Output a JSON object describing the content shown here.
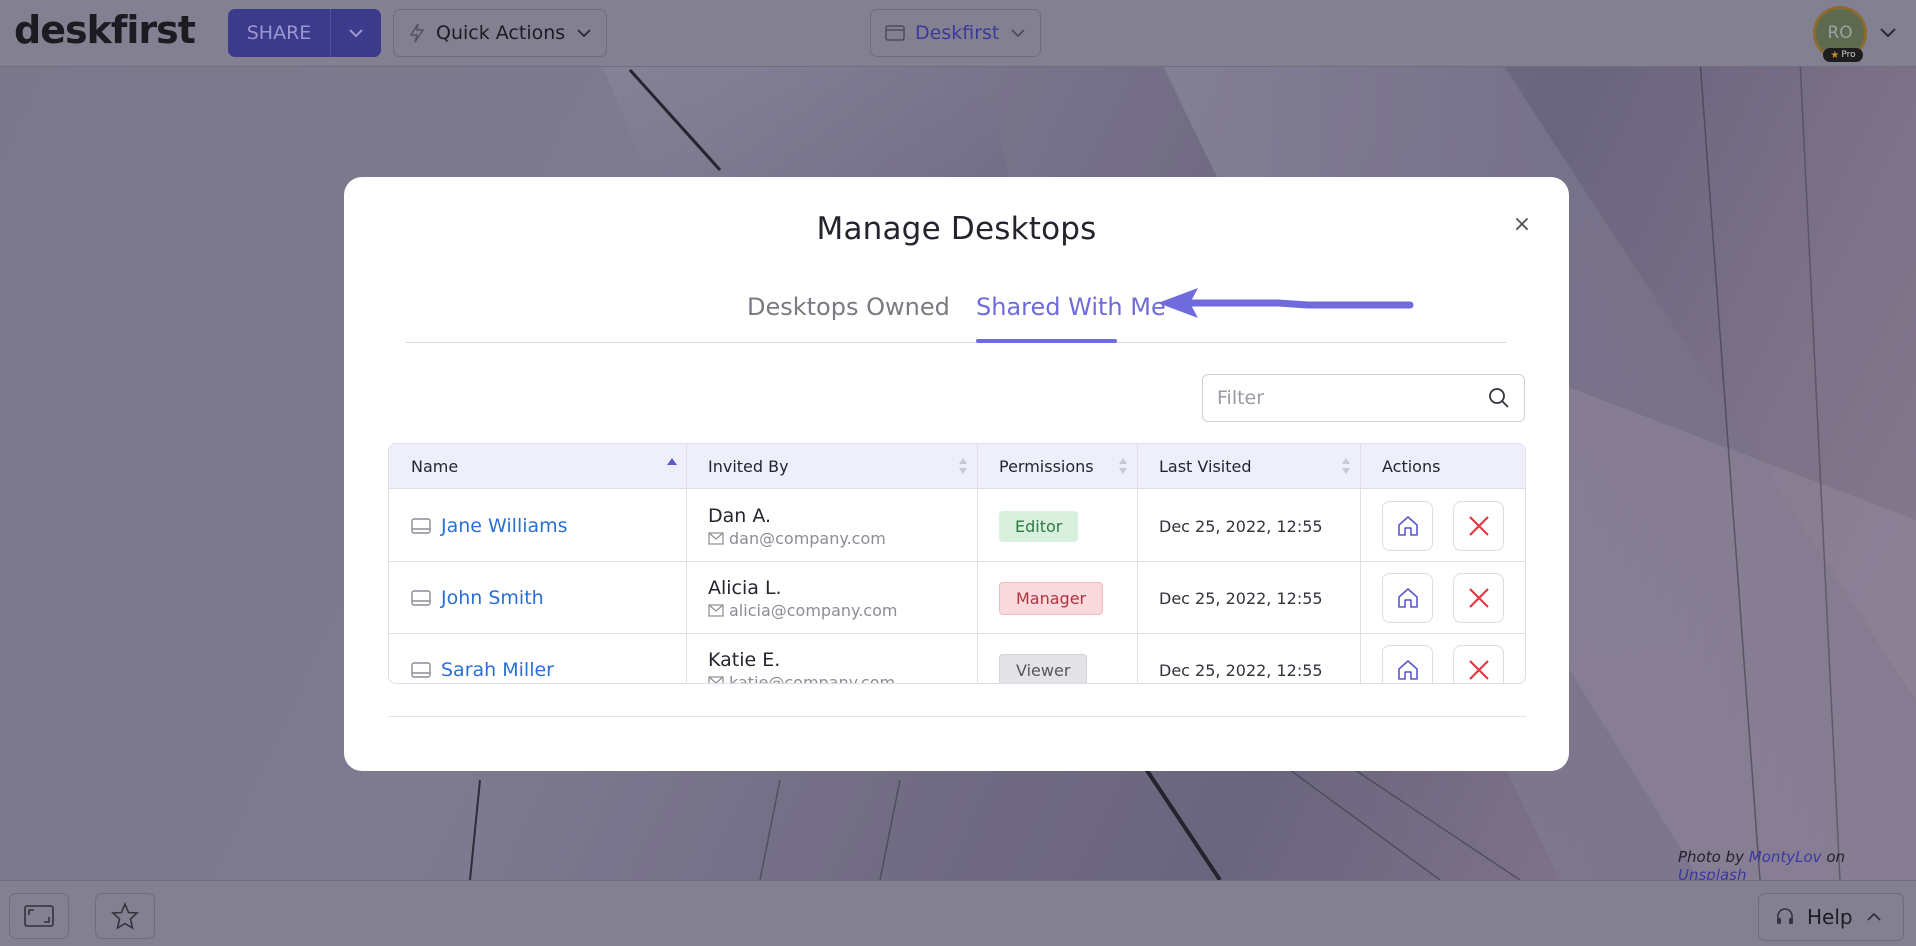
{
  "topbar": {
    "logo": "deskfirst",
    "share_label": "SHARE",
    "quick_actions_label": "Quick Actions",
    "desktop_label": "Deskfirst",
    "avatar_initials": "RO",
    "pro_label": "Pro"
  },
  "bottombar": {
    "help_label": "Help"
  },
  "photo_credit": {
    "prefix": "Photo by",
    "author": "MontyLov",
    "on": "on",
    "site": "Unsplash"
  },
  "modal": {
    "title": "Manage Desktops",
    "close_symbol": "×",
    "tabs": [
      {
        "label": "Desktops Owned",
        "active": false
      },
      {
        "label": "Shared With Me",
        "active": true
      }
    ],
    "filter_placeholder": "Filter",
    "columns": [
      "Name",
      "Invited By",
      "Permissions",
      "Last Visited",
      "Actions"
    ],
    "rows": [
      {
        "name": "Jane Williams",
        "inviter": "Dan A.",
        "email": "dan@company.com",
        "permission": "Editor",
        "last_visited": "Dec 25, 2022, 12:55"
      },
      {
        "name": "John Smith",
        "inviter": "Alicia L.",
        "email": "alicia@company.com",
        "permission": "Manager",
        "last_visited": "Dec 25, 2022, 12:55"
      },
      {
        "name": "Sarah Miller",
        "inviter": "Katie E.",
        "email": "katie@company.com",
        "permission": "Viewer",
        "last_visited": "Dec 25, 2022, 12:55"
      }
    ]
  },
  "colors": {
    "accent": "#6f6bdc",
    "link": "#2b6fd6",
    "editor_bg": "#d8f0dd",
    "editor_fg": "#2f7a45",
    "manager_bg": "#fadadd",
    "manager_fg": "#b3323f",
    "viewer_bg": "#e4e4e8",
    "viewer_fg": "#55555e",
    "delete": "#e0343f"
  }
}
